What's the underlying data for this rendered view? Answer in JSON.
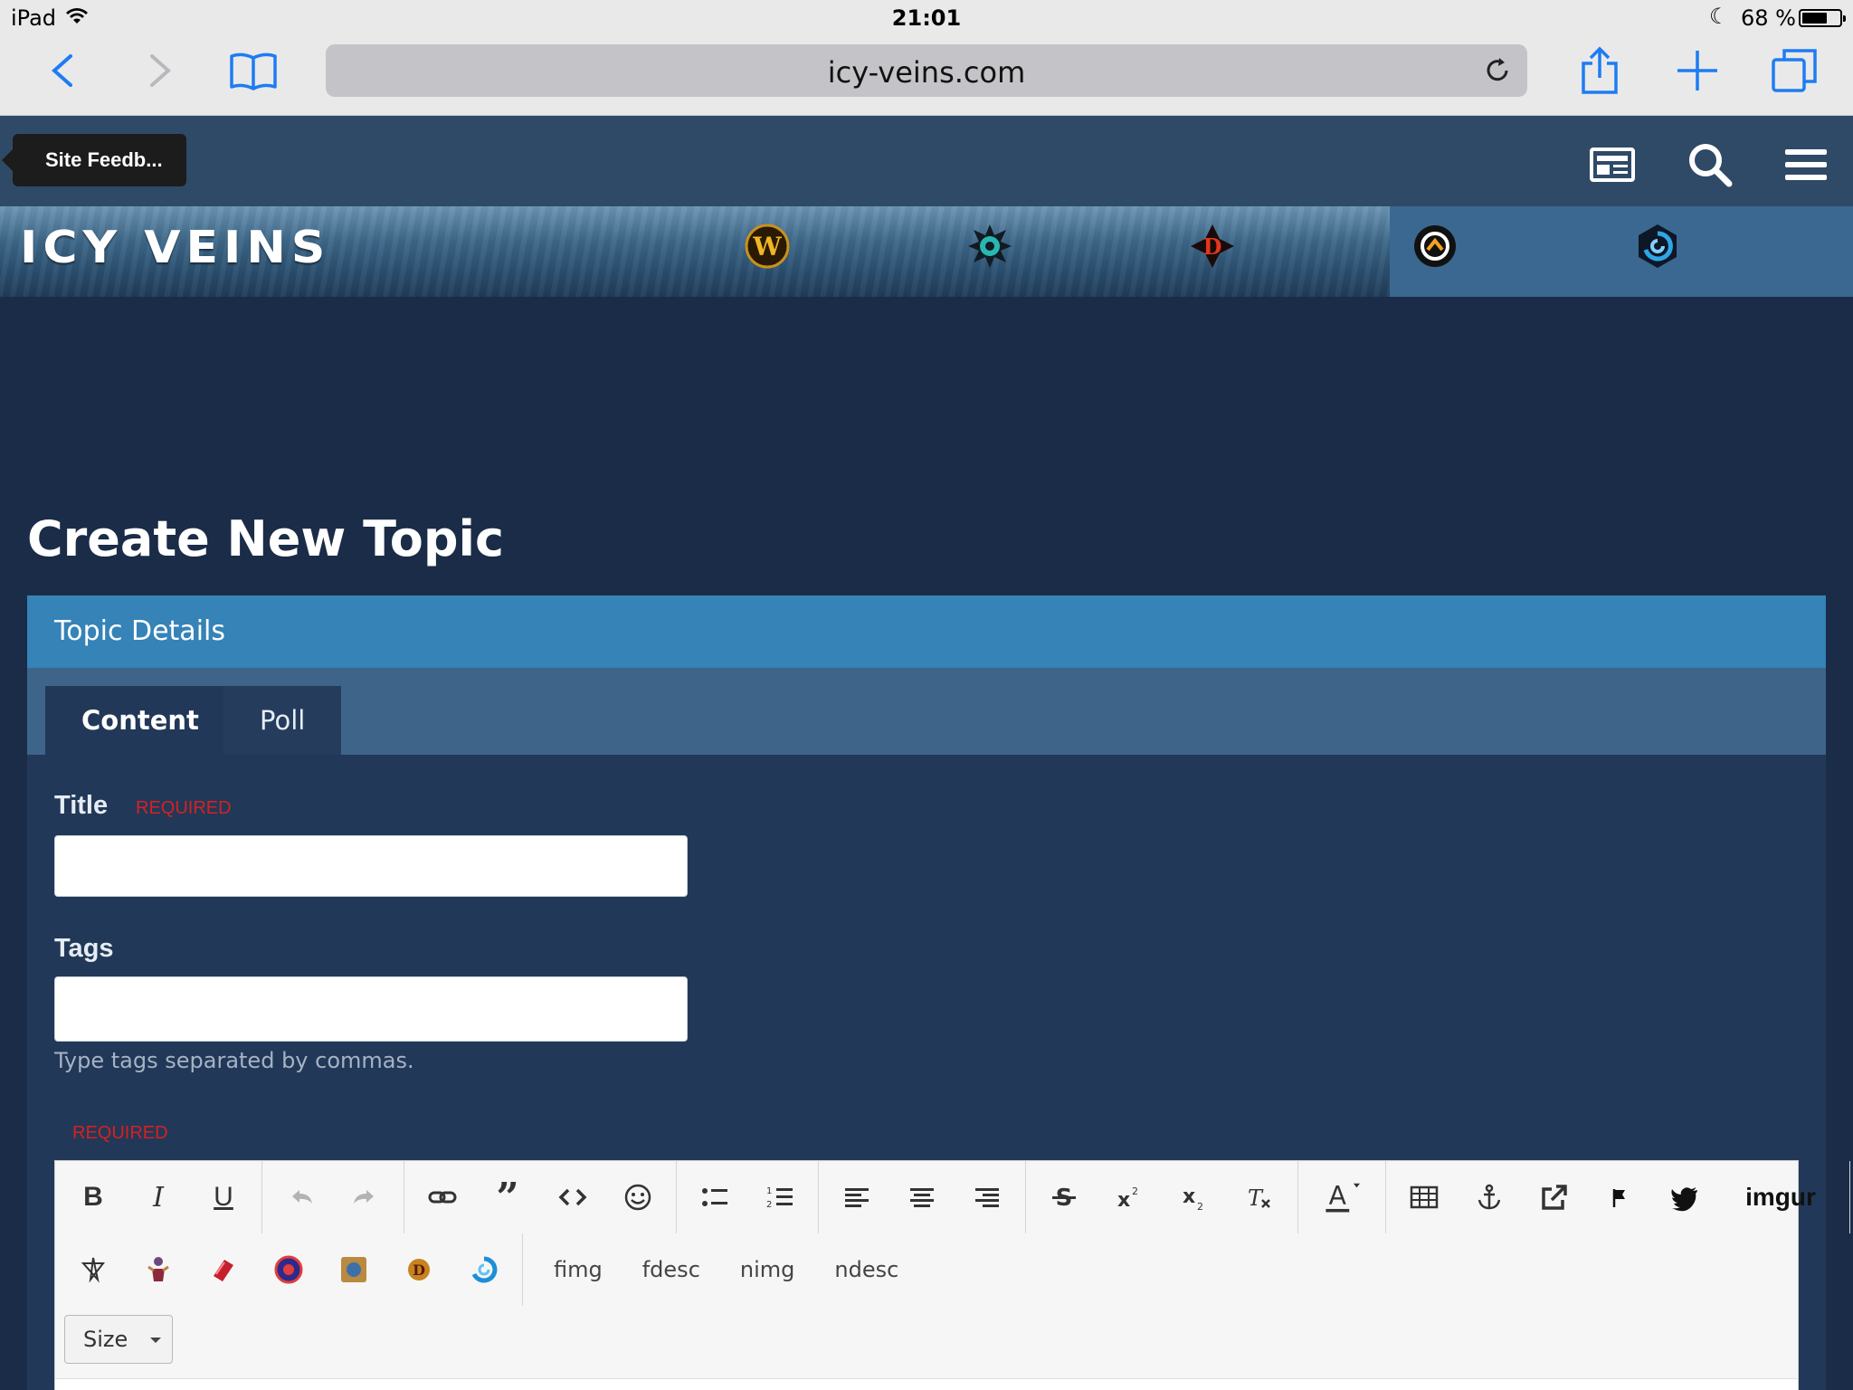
{
  "status_bar": {
    "device": "iPad",
    "time": "21:01",
    "battery_text": "68 %",
    "battery_level": 0.68
  },
  "browser": {
    "url": "icy-veins.com"
  },
  "site": {
    "feedback_label": "Site Feedb...",
    "game_icons": [
      "wow-icon",
      "hearthstone-icon",
      "diablo-icon",
      "overwatch-icon",
      "heroes-icon"
    ]
  },
  "page": {
    "title": "Create New Topic",
    "panel_title": "Topic Details",
    "tabs": [
      {
        "label": "Content",
        "active": true
      },
      {
        "label": "Poll",
        "active": false
      }
    ],
    "fields": {
      "title_label": "Title",
      "required": "REQUIRED",
      "tags_label": "Tags",
      "tags_hint": "Type tags separated by commas.",
      "title_value": "",
      "tags_value": ""
    }
  },
  "editor": {
    "required": "REQUIRED",
    "row1": {
      "bold": "B",
      "italic": "I",
      "underline": "U",
      "imgur": "imgur"
    },
    "row2_text": [
      "fimg",
      "fdesc",
      "nimg",
      "ndesc"
    ],
    "size_label": "Size"
  },
  "colors": {
    "page_bg": "#1a2c47",
    "panel_header": "#3583b7",
    "tabs_bar": "#3e6589",
    "required": "#d52121",
    "ios_blue": "#1e7cf2"
  }
}
